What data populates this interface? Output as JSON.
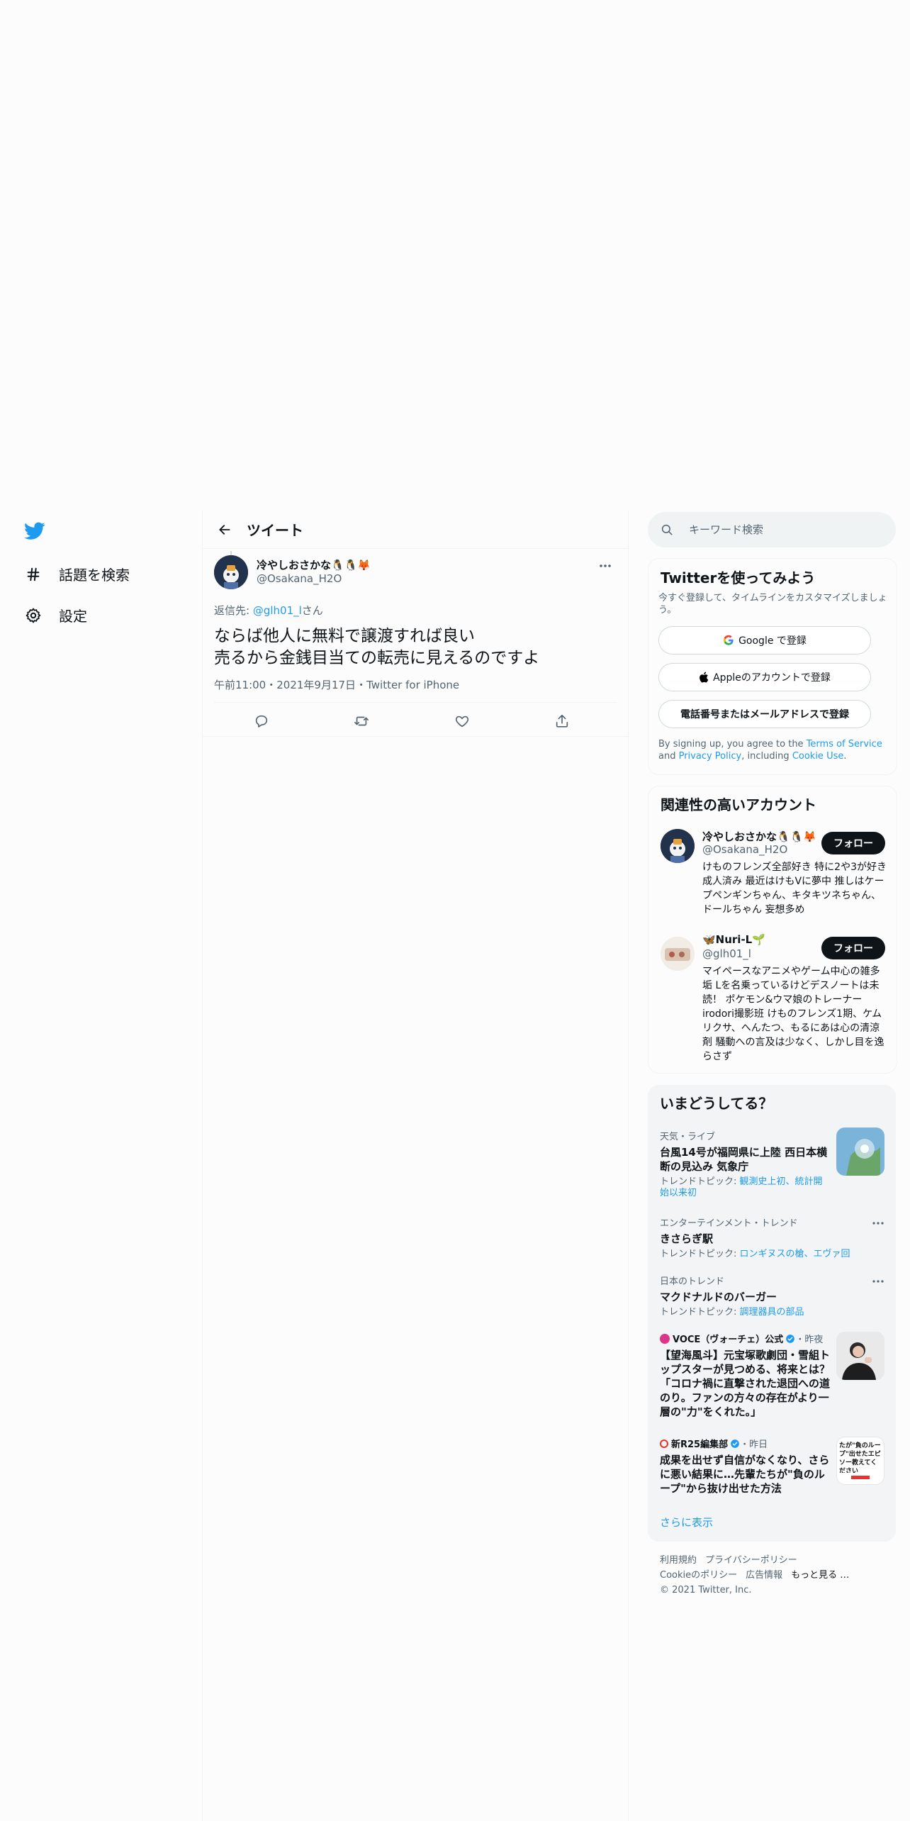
{
  "nav": {
    "explore_label": "話題を検索",
    "settings_label": "設定"
  },
  "header": {
    "title": "ツイート"
  },
  "tweet": {
    "author_name": "冷やしおさかな🐧🐧🦊",
    "author_handle": "@Osakana_H2O",
    "reply_prefix": "返信先: ",
    "reply_handle": "@glh01_l",
    "reply_suffix": "さん",
    "text": "ならば他人に無料で譲渡すれば良い\n売るから金銭目当ての転売に見えるのですよ",
    "time": "午前11:00",
    "date": "2021年9月17日",
    "source": "Twitter for iPhone",
    "dot": "・"
  },
  "search": {
    "placeholder": "キーワード検索"
  },
  "signup": {
    "title": "Twitterを使ってみよう",
    "subtitle": "今すぐ登録して、タイムラインをカスタマイズしましょう。",
    "google_label": "Google で登録",
    "apple_label": "Appleのアカウントで登録",
    "phone_label": "電話番号またはメールアドレスで登録",
    "legal_1": "By signing up, you agree to the ",
    "legal_terms": "Terms of Service",
    "legal_2": " and ",
    "legal_privacy": "Privacy Policy",
    "legal_3": ", including ",
    "legal_cookie": "Cookie Use",
    "legal_4": "."
  },
  "related": {
    "title": "関連性の高いアカウント",
    "accounts": [
      {
        "name": "冷やしおさかな🐧🐧🦊",
        "handle": "@Osakana_H2O",
        "bio": "けものフレンズ全部好き 特に2や3が好き 成人済み 最近はけもVに夢中 推しはケープペンギンちゃん、キタキツネちゃん、ドールちゃん 妄想多め",
        "follow_label": "フォロー"
      },
      {
        "name": "🦋Nuri-L🌱",
        "handle": "@glh01_l",
        "bio": "マイペースなアニメやゲーム中心の雑多垢 Lを名乗っているけどデスノートは未読！ ポケモン&ウマ娘のトレーナー irodori撮影班 けものフレンズ1期、ケムリクサ、へんたつ、もるにあは心の清涼剤 騒動への言及は少なく、しかし目を逸らさず",
        "follow_label": "フォロー"
      }
    ]
  },
  "trends": {
    "title": "いまどうしてる？",
    "items": [
      {
        "category": "天気・ライブ",
        "headline": "台風14号が福岡県に上陸 西日本横断の見込み 気象庁",
        "topic_prefix": "トレンドトピック: ",
        "topic": "観測史上初、統計開始以来初"
      },
      {
        "category": "エンターテインメント・トレンド",
        "headline": "きさらぎ駅",
        "topic_prefix": "トレンドトピック: ",
        "topic": "ロンギヌスの槍、エヴァ回"
      },
      {
        "category": "日本のトレンド",
        "headline": "マクドナルドのバーガー",
        "topic_prefix": "トレンドトピック: ",
        "topic": "調理器具の部品"
      },
      {
        "source": "VOCE（ヴォーチェ）公式",
        "time": "・昨夜",
        "headline": "【望海風斗】元宝塚歌劇団・雪組トップスターが見つめる、将来とは？「コロナ禍に直撃された退団への道のり。ファンの方々の存在がより一層の\"力\"をくれた。」"
      },
      {
        "source": "新R25編集部",
        "time": "・昨日",
        "headline": "成果を出せず自信がなくなり、さらに悪い結果に…先輩たちが\"負のループ\"から抜け出せた方法",
        "thumb_text": "たが\"負のループ\"出せたエピソー教えてください"
      }
    ],
    "show_more": "さらに表示"
  },
  "footer": {
    "terms": "利用規約",
    "privacy": "プライバシーポリシー",
    "cookie": "Cookieのポリシー",
    "ads": "広告情報",
    "more": "もっと見る …",
    "copyright": "© 2021 Twitter, Inc."
  },
  "colors": {
    "accent": "#1d9bf0",
    "text": "#0f1419",
    "muted": "#536471",
    "border": "#eff3f4",
    "follow_bg": "#0f1419"
  }
}
